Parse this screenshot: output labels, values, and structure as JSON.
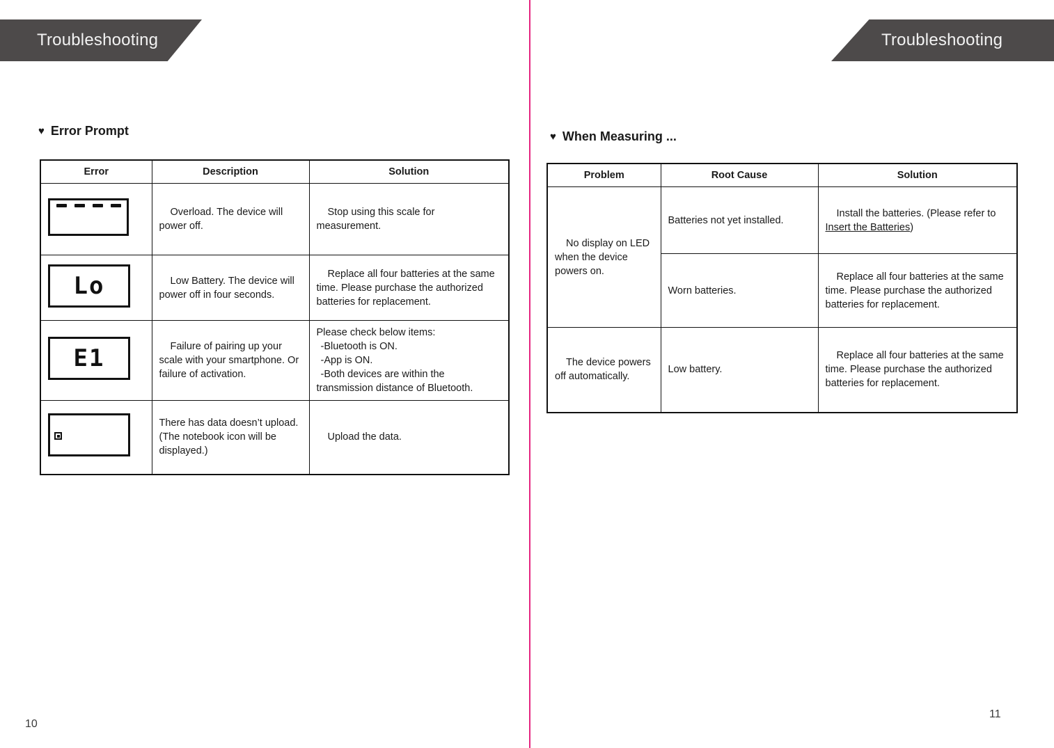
{
  "spread": {
    "left_page": {
      "banner_title": "Troubleshooting",
      "folio": "10",
      "section": {
        "bullet": "heart-icon",
        "title": "Error Prompt"
      },
      "table": {
        "headers": [
          "Error",
          "Description",
          "Solution"
        ],
        "rows": [
          {
            "icon": {
              "type": "lcd-dashes",
              "segments": [
                "-",
                "-",
                "-",
                "-"
              ]
            },
            "description": "Overload. The device will power off.",
            "solution": "Stop using this scale for measurement."
          },
          {
            "icon": {
              "type": "lcd-text",
              "value": "Lo"
            },
            "description": "Low Battery. The device will power off in four seconds.",
            "solution": "Replace all four batteries at the same time. Please purchase the authorized batteries for replacement."
          },
          {
            "icon": {
              "type": "lcd-text",
              "value": "E1"
            },
            "description": "Failure of pairing up your scale with your smartphone. Or failure of activation.",
            "solution_lines": [
              "Please check below items:",
              "-Bluetooth is ON.",
              "-App is ON.",
              "-Both devices are within the transmission distance of Bluetooth."
            ]
          },
          {
            "icon": {
              "type": "lcd-notebook",
              "value": ""
            },
            "description": "There has data doesn’t upload. (The notebook icon will be displayed.)",
            "solution": "Upload the data."
          }
        ]
      }
    },
    "right_page": {
      "banner_title": "Troubleshooting",
      "folio": "11",
      "section": {
        "bullet": "heart-icon",
        "title": "When Measuring ..."
      },
      "table": {
        "headers": [
          "Problem",
          "Root Cause",
          "Solution"
        ],
        "rows": [
          {
            "problem": "No display on LED when the device powers on.",
            "root_cause": "Batteries not yet installed.",
            "solution_prefix": "Install the batteries. (Please refer to ",
            "solution_link": "Insert the Batteries",
            "solution_suffix": ")"
          },
          {
            "problem": "",
            "root_cause": "Worn batteries.",
            "solution": "Replace all four batteries at the same time. Please purchase the authorized batteries for replacement."
          },
          {
            "problem": "The device powers off automatically.",
            "root_cause": "Low battery.",
            "solution": "Replace all four batteries at the same time. Please purchase the authorized batteries for replacement."
          }
        ]
      }
    },
    "colors": {
      "banner": "#4d4a4a",
      "banner_text": "#f2f2f2",
      "gutter_line": "#e5257f",
      "rule": "#111111",
      "body_text": "#1a1a1a"
    }
  }
}
